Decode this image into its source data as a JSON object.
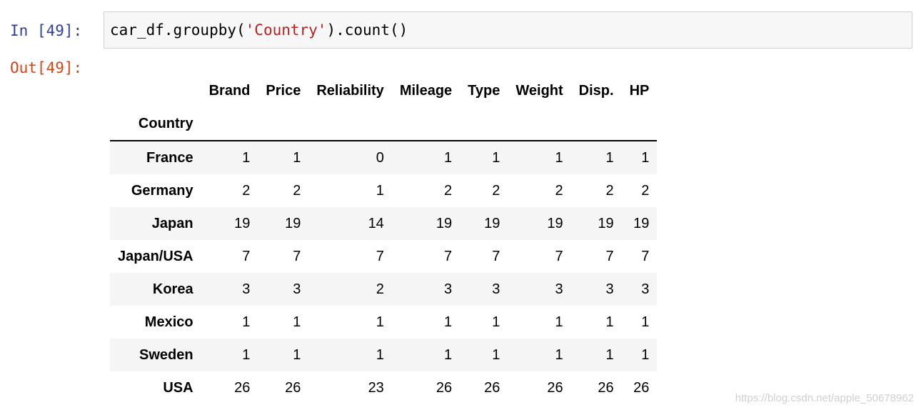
{
  "cell": {
    "in_prompt": "In [49]:",
    "out_prompt": "Out[49]:",
    "code_prefix": "car_df.groupby(",
    "code_string": "'Country'",
    "code_suffix": ").count()"
  },
  "table": {
    "columns": [
      "Brand",
      "Price",
      "Reliability",
      "Mileage",
      "Type",
      "Weight",
      "Disp.",
      "HP"
    ],
    "index_name": "Country",
    "rows": [
      {
        "label": "France",
        "values": [
          "1",
          "1",
          "0",
          "1",
          "1",
          "1",
          "1",
          "1"
        ]
      },
      {
        "label": "Germany",
        "values": [
          "2",
          "2",
          "1",
          "2",
          "2",
          "2",
          "2",
          "2"
        ]
      },
      {
        "label": "Japan",
        "values": [
          "19",
          "19",
          "14",
          "19",
          "19",
          "19",
          "19",
          "19"
        ]
      },
      {
        "label": "Japan/USA",
        "values": [
          "7",
          "7",
          "7",
          "7",
          "7",
          "7",
          "7",
          "7"
        ]
      },
      {
        "label": "Korea",
        "values": [
          "3",
          "3",
          "2",
          "3",
          "3",
          "3",
          "3",
          "3"
        ]
      },
      {
        "label": "Mexico",
        "values": [
          "1",
          "1",
          "1",
          "1",
          "1",
          "1",
          "1",
          "1"
        ]
      },
      {
        "label": "Sweden",
        "values": [
          "1",
          "1",
          "1",
          "1",
          "1",
          "1",
          "1",
          "1"
        ]
      },
      {
        "label": "USA",
        "values": [
          "26",
          "26",
          "23",
          "26",
          "26",
          "26",
          "26",
          "26"
        ]
      }
    ]
  },
  "watermark": "https://blog.csdn.net/apple_50678962"
}
